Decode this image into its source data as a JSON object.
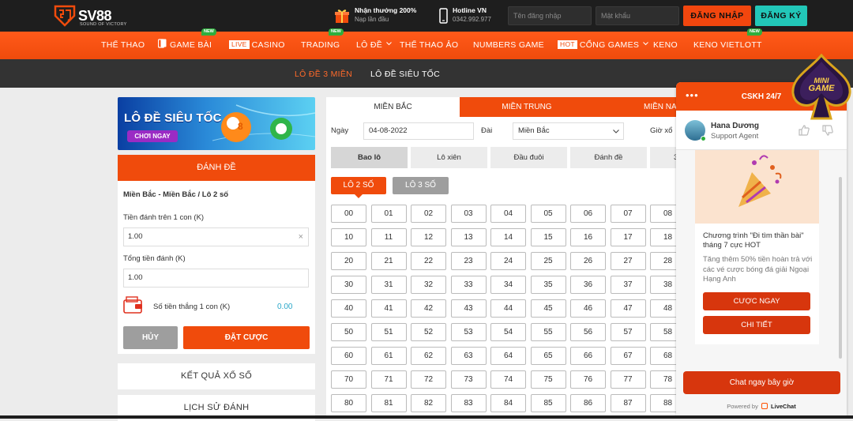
{
  "header": {
    "logo_text": "SV88",
    "logo_sub": "SOUND OF VICTORY",
    "promo_title": "Nhận thưởng 200%",
    "promo_sub": "Nạp lần đầu",
    "hotline_title": "Hotline VN",
    "hotline_number": "0342.992.977",
    "username_placeholder": "Tên đăng nhập",
    "password_placeholder": "Mật khẩu",
    "login_label": "ĐĂNG NHẬP",
    "register_label": "ĐĂNG KÝ"
  },
  "nav": {
    "new_badge": "NEW",
    "live_badge": "LIVE",
    "hot_badge": "HOT",
    "items": [
      "THỂ THAO",
      "GAME BÀI",
      "CASINO",
      "TRADING",
      "LÔ ĐỀ",
      "THỂ THAO ẢO",
      "NUMBERS GAME",
      "CỔNG GAMES",
      "KENO",
      "KENO VIETLOTT"
    ]
  },
  "subnav": {
    "items": [
      "LÔ ĐỀ 3 MIỀN",
      "LÔ ĐỀ SIÊU TỐC"
    ]
  },
  "banner": {
    "title": "LÔ ĐỀ SIÊU TỐC",
    "cta": "CHƠI NGAY"
  },
  "bet_panel": {
    "header": "ĐÁNH ĐỀ",
    "summary": "Miền Bắc - Miền Bắc / Lô 2 số",
    "stake_label": "Tiền đánh trên 1 con (K)",
    "stake_value": "1.00",
    "total_label": "Tổng tiền đánh (K)",
    "total_value": "1.00",
    "win_label": "Số tiền thắng 1 con (K)",
    "win_value": "0.00",
    "cancel_label": "HỦY",
    "submit_label": "ĐẶT CƯỢC"
  },
  "accordions": [
    "KẾT QUẢ XỔ SỐ",
    "LỊCH SỬ ĐÁNH"
  ],
  "main": {
    "region_tabs": [
      "MIỀN BẮC",
      "MIỀN TRUNG",
      "MIỀN NA"
    ],
    "date_label": "Ngày",
    "date_value": "04-08-2022",
    "station_label": "Đài",
    "station_value": "Miền Bắc",
    "time_label": "Giờ xổ",
    "bet_types": [
      "Bao lô",
      "Lô xiên",
      "Đầu đuôi",
      "Đánh đề",
      "3"
    ],
    "sub_types": [
      "LÔ 2 SỐ",
      "LÔ 3 SỐ"
    ],
    "number_rows": [
      [
        "00",
        "01",
        "02",
        "03",
        "04",
        "05",
        "06",
        "07",
        "08"
      ],
      [
        "10",
        "11",
        "12",
        "13",
        "14",
        "15",
        "16",
        "17",
        "18"
      ],
      [
        "20",
        "21",
        "22",
        "23",
        "24",
        "25",
        "26",
        "27",
        "28"
      ],
      [
        "30",
        "31",
        "32",
        "33",
        "34",
        "35",
        "36",
        "37",
        "38"
      ],
      [
        "40",
        "41",
        "42",
        "43",
        "44",
        "45",
        "46",
        "47",
        "48"
      ],
      [
        "50",
        "51",
        "52",
        "53",
        "54",
        "55",
        "56",
        "57",
        "58"
      ],
      [
        "60",
        "61",
        "62",
        "63",
        "64",
        "65",
        "66",
        "67",
        "68"
      ],
      [
        "70",
        "71",
        "72",
        "73",
        "74",
        "75",
        "76",
        "77",
        "78"
      ],
      [
        "80",
        "81",
        "82",
        "83",
        "84",
        "85",
        "86",
        "87",
        "88"
      ]
    ]
  },
  "chat": {
    "header": "CSKH 24/7",
    "agent_name": "Hana Dương",
    "agent_role": "Support Agent",
    "card_title": "Chương trình \"Đi tìm thần bài\" tháng 7 cực HOT",
    "card_text": "Tăng thêm 50% tiền hoàn trả với các vé cược bóng đá giải Ngoại Hạng Anh",
    "btn_bet": "CƯỢC NGAY",
    "btn_detail": "CHI TIẾT",
    "chat_now": "Chat ngay bây giờ",
    "powered": "Powered by",
    "powered_brand": "LiveChat"
  },
  "mini_game": {
    "line1": "MINI",
    "line2": "GAME"
  },
  "colors": {
    "accent": "#f04b0c",
    "teal": "#22c7b8",
    "dark": "#1e1e1e"
  }
}
